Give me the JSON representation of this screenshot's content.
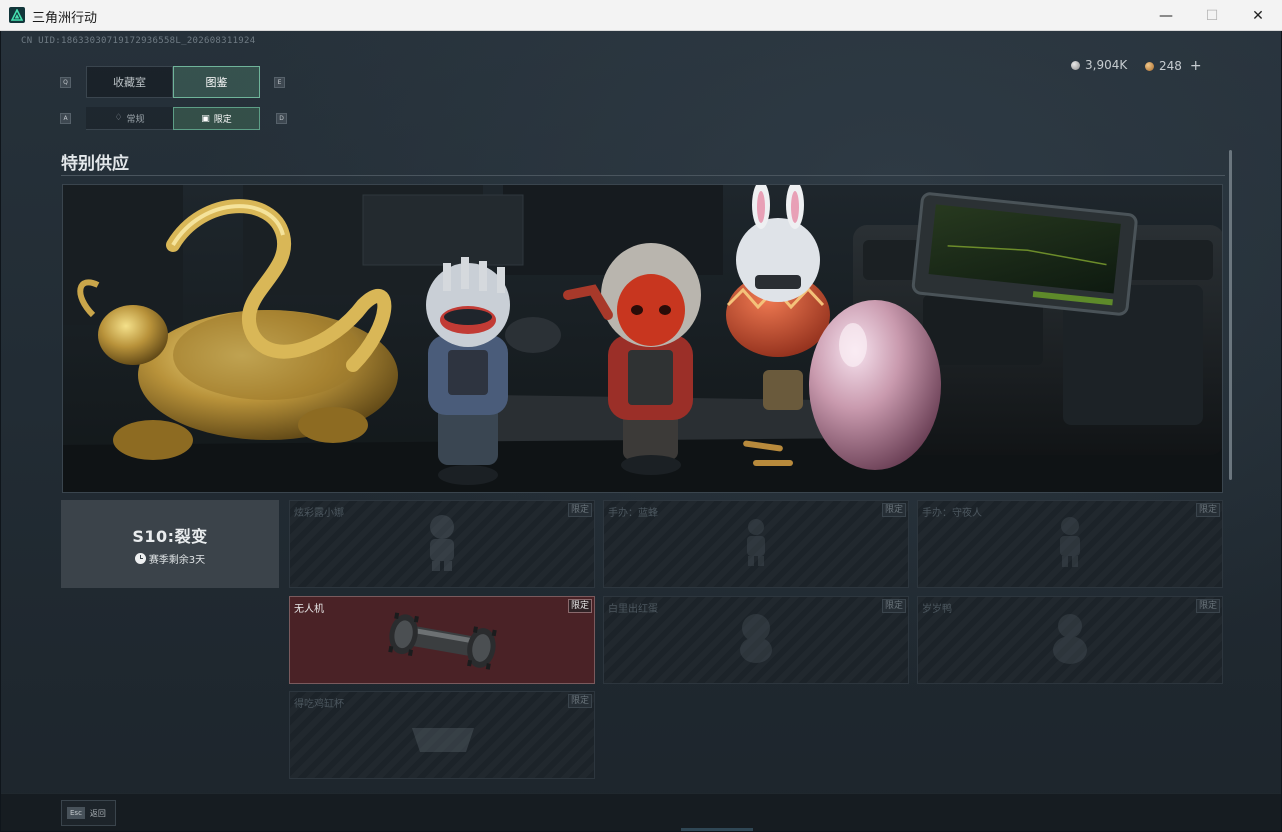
{
  "window": {
    "title": "三角洲行动",
    "minimize_glyph": "—",
    "maximize_glyph": "☐",
    "close_glyph": "✕"
  },
  "header": {
    "uid": "CN UID:18633030719172936558L_202608311924",
    "currencies": [
      {
        "icon": "silver-coin-icon",
        "value": "3,904K"
      },
      {
        "icon": "bronze-coin-icon",
        "value": "248"
      }
    ],
    "add_glyph": "+"
  },
  "tabs": {
    "prev_key": "Q",
    "next_key": "E",
    "items": [
      {
        "label": "收藏室",
        "active": false
      },
      {
        "label": "图鉴",
        "active": true
      }
    ]
  },
  "subtabs": {
    "prev_key": "A",
    "next_key": "D",
    "items": [
      {
        "label": "常规",
        "icon": "flame-icon",
        "active": false
      },
      {
        "label": "限定",
        "icon": "calendar-icon",
        "active": true
      }
    ]
  },
  "section": {
    "title": "特别供应"
  },
  "season": {
    "name": "S10:裂变",
    "remaining": "赛季剩余3天"
  },
  "items": [
    {
      "name": "炫彩露小娜",
      "badge": "限定",
      "selected": false
    },
    {
      "name": "手办：蓝蜂",
      "badge": "限定",
      "selected": false
    },
    {
      "name": "手办：守夜人",
      "badge": "限定",
      "selected": false
    },
    {
      "name": "无人机",
      "badge": "限定",
      "selected": true
    },
    {
      "name": "白里出红蛋",
      "badge": "限定",
      "selected": false
    },
    {
      "name": "岁岁鸭",
      "badge": "限定",
      "selected": false
    },
    {
      "name": "得吃鸡缸杯",
      "badge": "限定",
      "selected": false
    }
  ],
  "footer": {
    "esc_key": "Esc",
    "back_label": "返回"
  },
  "colors": {
    "accent": "#6fb49a",
    "selected_card": "#4a2226",
    "background": "#222c34"
  }
}
